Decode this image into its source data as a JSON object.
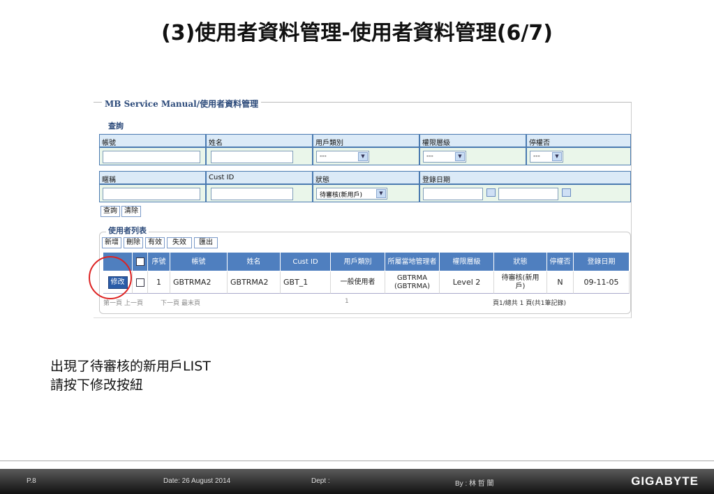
{
  "slide": {
    "title": "(3)使用者資料管理-使用者資料管理(6/7)",
    "body_lines": [
      "出現了待審核的新用戶LIST",
      "請按下修改按紐"
    ]
  },
  "app": {
    "title": "MB Service Manual/使用者資料管理",
    "query_section": "查詢",
    "list_section": "使用者列表"
  },
  "query": {
    "headers_row1": [
      "帳號",
      "姓名",
      "用戶類別",
      "權限層級",
      "停權否"
    ],
    "headers_row2": [
      "暱稱",
      "Cust ID",
      "狀態",
      "登錄日期"
    ],
    "user_type_value": "---",
    "level_value": "---",
    "suspended_value": "---",
    "status_value": "待審核(新用戶)",
    "buttons": {
      "search": "查詢",
      "clear": "清除"
    }
  },
  "list": {
    "buttons": {
      "add": "新增",
      "delete": "刪除",
      "valid": "有效",
      "invalid": "失效",
      "export": "匯出"
    },
    "columns": [
      "序號",
      "帳號",
      "姓名",
      "Cust ID",
      "用戶類別",
      "所屬當地管理者",
      "權限層級",
      "狀態",
      "停權否",
      "登錄日期"
    ],
    "row": {
      "edit_label": "修改",
      "seq": "1",
      "account": "GBTRMA2",
      "name": "GBTRMA2",
      "cust_id": "GBT_1",
      "user_type": "一般使用者",
      "manager": "GBTRMA (GBTRMA)",
      "level": "Level 2",
      "status": "待審核(新用戶)",
      "suspended": "N",
      "date": "09-11-05"
    },
    "pager": {
      "first": "第一頁",
      "prev": "上一頁",
      "next": "下一頁",
      "last": "最末頁",
      "page_num": "1",
      "summary": "頁1/總共 1 頁(共1筆記錄)"
    }
  },
  "footer": {
    "page": "P.8",
    "date": "Date: 26 August 2014",
    "dept": "Dept :",
    "by": "By : 林 哲 闓",
    "logo": "GIGABYTE"
  },
  "colors": {
    "header_blue": "#4f7fbf",
    "query_header": "#dbeaf7",
    "query_cell": "#eaf6ea",
    "annotation": "#dd2222"
  }
}
